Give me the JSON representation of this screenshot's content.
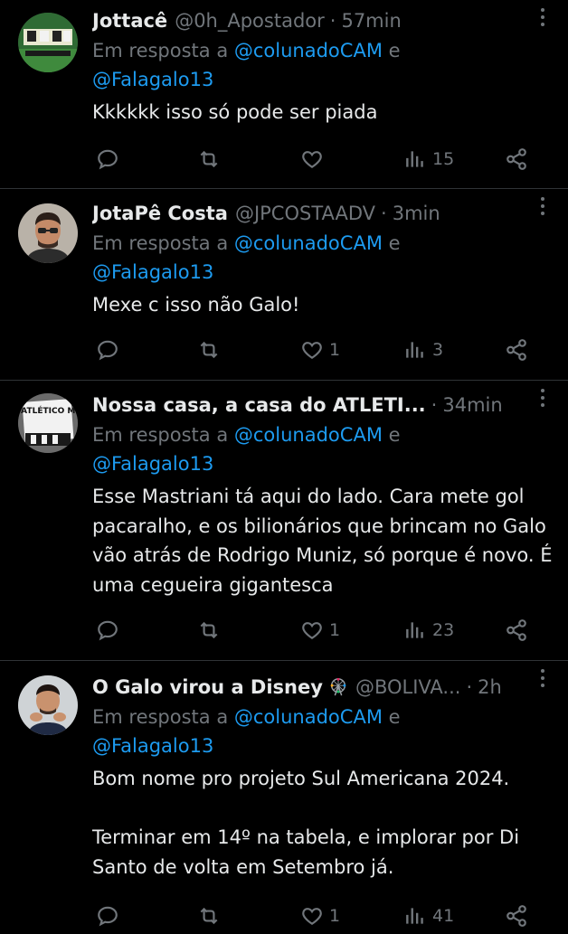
{
  "colors": {
    "background": "#000000",
    "text": "#e7e9ea",
    "secondary": "#71767b",
    "mention": "#1d9bf0",
    "divider": "#2f3336"
  },
  "replies": [
    {
      "name": "Jottacê",
      "handle": "@0h_Apostador",
      "time": "57min",
      "replying_prefix": "Em resposta a",
      "mention1": "@colunadoCAM",
      "conj": "e",
      "mention2": "@Falagalo13",
      "text": "Kkkkkk isso só pode ser piada",
      "likes": "",
      "views": "15",
      "avatar_icon": "avatar-football-team-photo"
    },
    {
      "name": "JotaPê Costa",
      "handle": "@JPCOSTAADV",
      "time": "3min",
      "replying_prefix": "Em resposta a",
      "mention1": "@colunadoCAM",
      "conj": "e",
      "mention2": "@Falagalo13",
      "text": "Mexe c isso não Galo!",
      "likes": "1",
      "views": "3",
      "avatar_icon": "avatar-man-glasses-photo"
    },
    {
      "name": "Nossa casa, a casa do ATLETI...",
      "handle": "",
      "time": "34min",
      "replying_prefix": "Em resposta a",
      "mention1": "@colunadoCAM",
      "conj": "e",
      "mention2": "@Falagalo13",
      "text": "Esse Mastriani tá aqui do lado. Cara mete gol pacaralho, e os bilionários que brincam no Galo vão atrás de Rodrigo Muniz, só porque é novo. É uma cegueira gigantesca",
      "likes": "1",
      "views": "23",
      "avatar_icon": "avatar-clube-atletico-mineiro-flag",
      "avatar_text": "CLUBE ATLÉTICO MINEIRO"
    },
    {
      "name": "O Galo virou a Disney",
      "handle": "@BOLIVA...",
      "time": "2h",
      "replying_prefix": "Em resposta a",
      "mention1": "@colunadoCAM",
      "conj": "e",
      "mention2": "@Falagalo13",
      "text": "Bom nome pro projeto Sul Americana 2024.\n\nTerminar em 14º na tabela, e implorar por Di Santo de volta em Setembro já.",
      "likes": "1",
      "views": "41",
      "avatar_icon": "avatar-man-pose-photo",
      "name_emoji": "ferris-wheel-icon"
    }
  ],
  "icons": {
    "reply": "reply-icon",
    "repost": "repost-icon",
    "like": "heart-icon",
    "views": "views-chart-icon",
    "share": "share-icon",
    "more": "more-options-icon"
  }
}
